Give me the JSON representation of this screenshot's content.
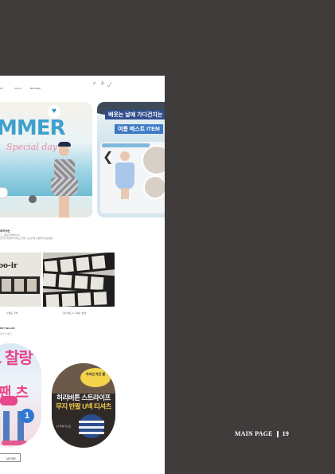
{
  "nav": {
    "items": [
      "ST",
      "VILLA",
      "REVIEW"
    ]
  },
  "header": {
    "icons": [
      "search-icon",
      "user-icon",
      "cart-icon"
    ],
    "cart_count": "0"
  },
  "banner1": {
    "headline": "MMER",
    "script": "Special day"
  },
  "banner2": {
    "tag1": "배웃는 날에 가디건지는",
    "tag2": "여름 베스트 ITEM"
  },
  "section1": {
    "title": "라이브는",
    "subtitle1": "그 그림은 특별하나다",
    "subtitle2": "당신의 특별한 라이프스타일, 오늘만의 감성에 맞춰보세요",
    "thumb_text": "oo-ir",
    "captions": [
      "2 얻는 가치",
      "기나 맞는 1 1 대는 '반영'"
    ]
  },
  "section2": {
    "title": "RST SELLER",
    "subtitle": "이번 주 베스트",
    "circle1": {
      "line1": "드 찰랑",
      "line2": "팬 츠",
      "badge": "1"
    },
    "circle2": {
      "bubble": "자외선 차단 쿨",
      "line1": "허리버튼 스트라이프",
      "line2": "무지 반팔 U넥 티셔츠",
      "caption": "빈 리뷰 리스트"
    }
  },
  "more_button": "MORE",
  "footer": {
    "label": "MAIN PAGE",
    "page": "19"
  },
  "colors": {
    "background": "#403c3b",
    "accent_pink": "#e8458a",
    "accent_blue": "#3fa0ce"
  }
}
